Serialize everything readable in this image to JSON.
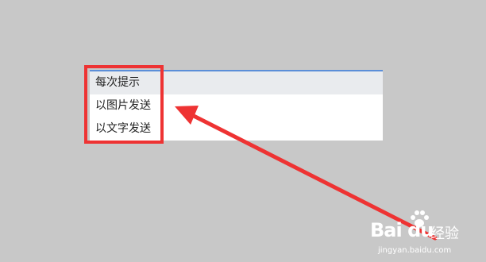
{
  "dropdown": {
    "options": [
      {
        "label": "每次提示",
        "selected": true
      },
      {
        "label": "以图片发送",
        "selected": false
      },
      {
        "label": "以文字发送",
        "selected": false
      }
    ]
  },
  "colors": {
    "background": "#c8c8c8",
    "annotation_red": "#ee3333",
    "selected_option_bg": "#e9ebee",
    "dropdown_border": "#5b8ed8"
  },
  "watermark": {
    "logo": "Bai du",
    "text": "经验",
    "url": "jingyan.baidu.com"
  }
}
